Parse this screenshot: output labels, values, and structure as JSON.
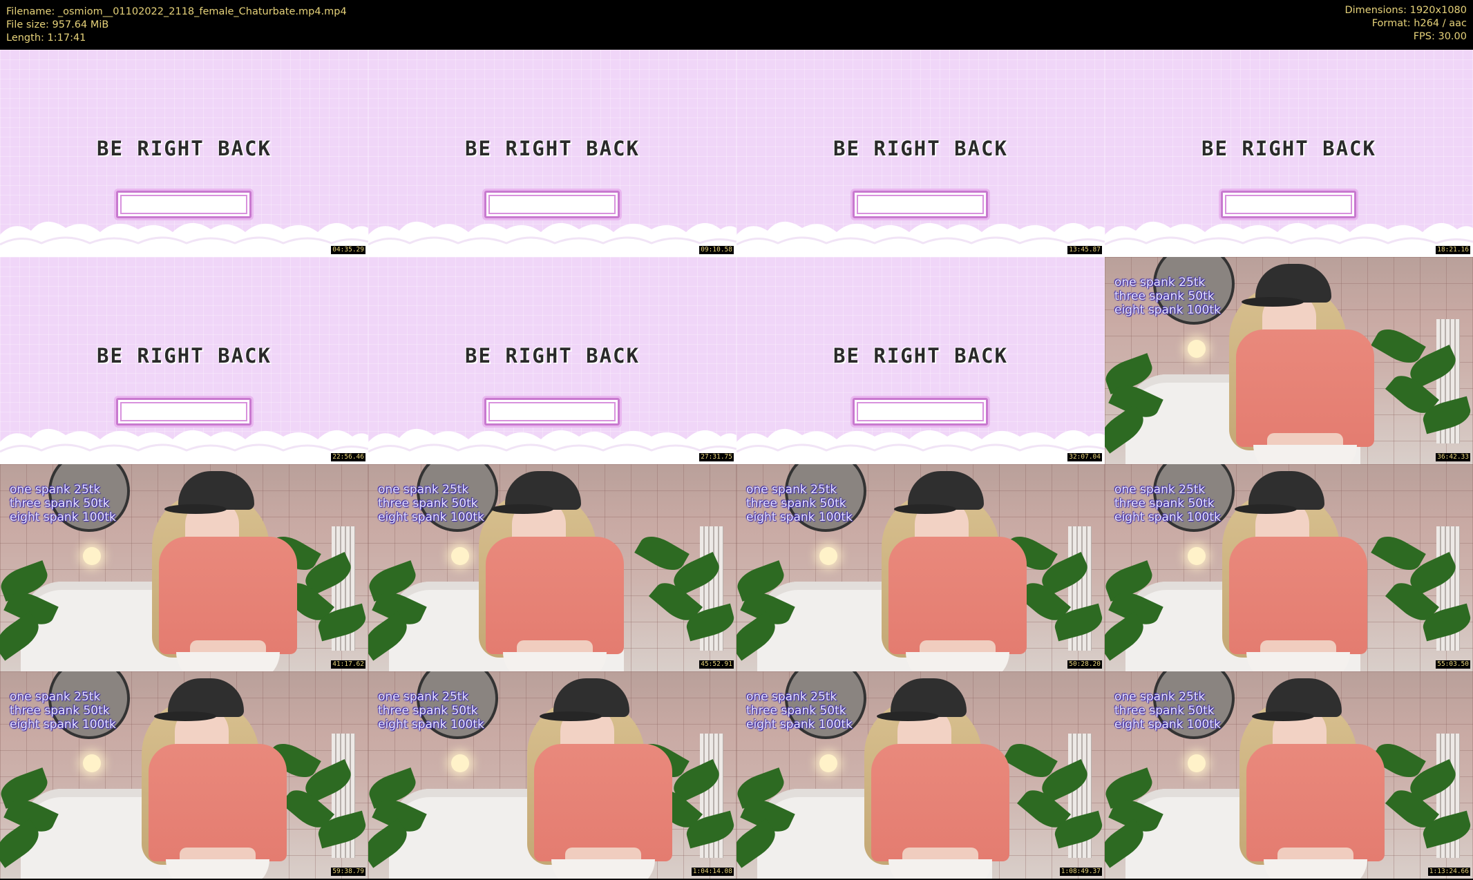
{
  "header": {
    "filename": "Filename: _osmiom__01102022_2118_female_Chaturbate.mp4.mp4",
    "filesize": "File size: 957.64 MiB",
    "length": "Length: 1:17:41",
    "dimensions": "Dimensions: 1920x1080",
    "format": "Format: h264 / aac",
    "fps": "FPS: 30.00"
  },
  "brb_text": "BE RIGHT BACK",
  "overlay": {
    "line1": "one spank 25tk",
    "line2": "three spank 50tk",
    "line3": "eight spank 100tk"
  },
  "thumbnails": [
    {
      "kind": "brb",
      "timestamp": "04:35.29"
    },
    {
      "kind": "brb",
      "timestamp": "09:10.58"
    },
    {
      "kind": "brb",
      "timestamp": "13:45.87"
    },
    {
      "kind": "brb",
      "timestamp": "18:21.16"
    },
    {
      "kind": "brb",
      "timestamp": "22:56.46"
    },
    {
      "kind": "brb",
      "timestamp": "27:31.75"
    },
    {
      "kind": "brb",
      "timestamp": "32:07.04"
    },
    {
      "kind": "cam",
      "timestamp": "36:42.33"
    },
    {
      "kind": "cam",
      "timestamp": "41:17.62"
    },
    {
      "kind": "cam",
      "timestamp": "45:52.91"
    },
    {
      "kind": "cam",
      "timestamp": "50:28.20"
    },
    {
      "kind": "cam",
      "timestamp": "55:03.50"
    },
    {
      "kind": "cam",
      "timestamp": "59:38.79"
    },
    {
      "kind": "cam",
      "timestamp": "1:04:14.08"
    },
    {
      "kind": "cam",
      "timestamp": "1:08:49.37"
    },
    {
      "kind": "cam",
      "timestamp": "1:13:24.66"
    }
  ]
}
